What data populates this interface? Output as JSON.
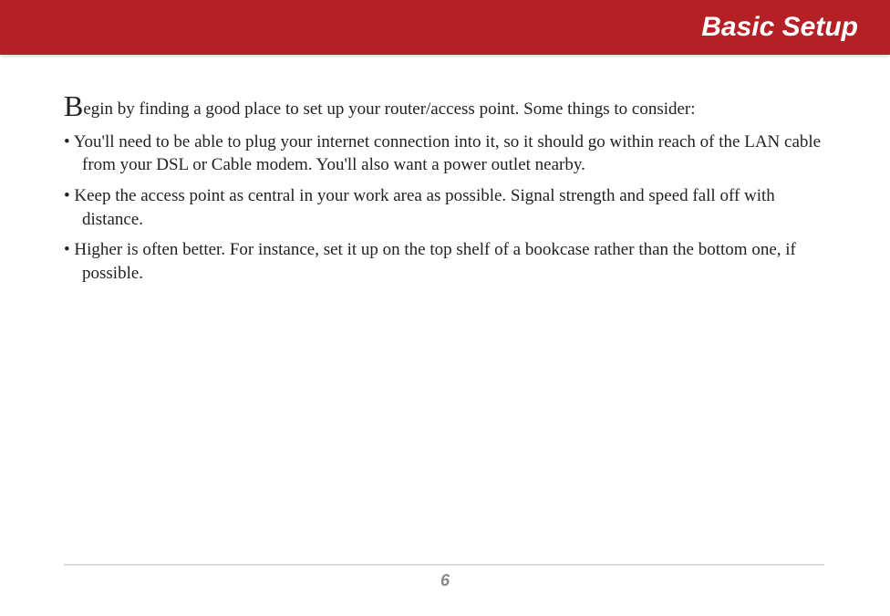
{
  "header": {
    "title": "Basic Setup"
  },
  "content": {
    "intro_dropcap": "B",
    "intro_rest": "egin by finding a good place to set up your router/access point.  Some things to consider:",
    "bullets": [
      "You'll need to be able to plug your internet connection into it, so it should go within reach of the LAN cable from your DSL or Cable modem.  You'll also want a power outlet nearby.",
      "Keep the access point as central in your work area as possible.  Signal strength and speed fall off with distance.",
      "Higher is often better.  For instance, set it up on the top shelf of a bookcase rather than the bottom one, if possible."
    ]
  },
  "footer": {
    "page_number": "6"
  }
}
